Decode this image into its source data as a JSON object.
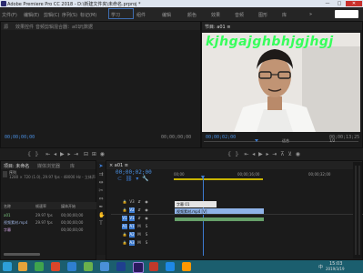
{
  "window": {
    "title": "Adobe Premiere Pro CC 2018 - D:\\新建文件夹\\未命名.prproj *"
  },
  "menu": [
    "文件(F)",
    "编辑(E)",
    "剪辑(C)",
    "序列(S)",
    "标记(M)",
    "图形(G)",
    "窗口(W)",
    "帮助(H)",
    "学习",
    "组件",
    "编辑",
    "颜色",
    "效果",
    "音频",
    "图形",
    "库"
  ],
  "source_panel": {
    "tabs": [
      "源",
      "效果控件",
      "音频剪辑混合器：a01",
      "元数据"
    ]
  },
  "program_panel": {
    "tab": "节目: a01 ≡",
    "overlay_text": "kjhgajghbhjgjhgj",
    "timecode_left": "00;00;02;00",
    "timecode_right": "00;00;13;25",
    "fit": "适合",
    "ratio": "1/2"
  },
  "source_timecodes": {
    "left": "00;00;00;00",
    "right": "00;00;00;00"
  },
  "project_panel": {
    "tabs": [
      "项目: 未命名",
      "媒体浏览器",
      "库"
    ],
    "info_line1": "序列",
    "info_line2": "1280 × 720 (1.0), 29.97 fps - 48000 Hz - 立体声",
    "columns": [
      "名称",
      "帧速率",
      "媒体开始"
    ],
    "rows": [
      {
        "name": "a01",
        "fps": "29.97 fps",
        "start": "00;00;00;00"
      },
      {
        "name": "视频素材.mp4",
        "fps": "29.97 fps",
        "start": "00;00;00;00"
      },
      {
        "name": "字幕",
        "fps": "",
        "start": "00;00;00;00"
      }
    ]
  },
  "timeline": {
    "tab": "× a01 ≡",
    "timecode": "00;00;02;00",
    "ruler": [
      "00;00",
      "00;00;16;00",
      "00;00;32;00"
    ],
    "tracks": [
      "V3",
      "V2",
      "V1",
      "A1",
      "A2",
      "A3"
    ],
    "clips": [
      {
        "label": "字幕 01",
        "track": "V2"
      },
      {
        "label": "视频素材.mp4 [V]",
        "track": "V1"
      }
    ]
  },
  "taskbar": {
    "time": "15:03",
    "date": "2019/3/19",
    "lang": "中"
  },
  "colors": {
    "accent": "#3c7bd1",
    "timecode": "#4a8fe0",
    "overlay": "#37ff5c"
  }
}
